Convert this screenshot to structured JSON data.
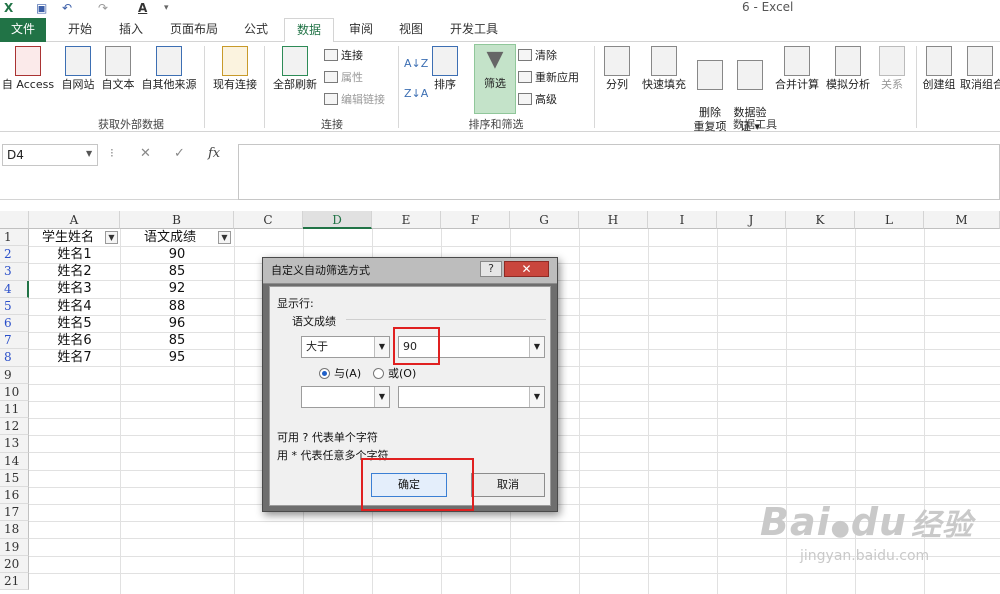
{
  "title_bar": {
    "title": "6 - Excel"
  },
  "tabs": [
    "文件",
    "开始",
    "插入",
    "页面布局",
    "公式",
    "数据",
    "审阅",
    "视图",
    "开发工具"
  ],
  "ribbon": {
    "external": {
      "btns": [
        "自 Access",
        "自网站",
        "自文本",
        "自其他来源",
        "现有连接"
      ],
      "label": "获取外部数据"
    },
    "connections": {
      "refresh": "全部刷新",
      "small": [
        "连接",
        "属性",
        "编辑链接"
      ],
      "label": "连接"
    },
    "sort": {
      "az": "A↓Z",
      "za": "Z↓A",
      "sort": "排序",
      "filter": "筛选",
      "small": [
        "清除",
        "重新应用",
        "高级"
      ],
      "label": "排序和筛选"
    },
    "tools": {
      "btns": [
        "分列",
        "快速填充",
        "删除\n重复项",
        "数据验\n证 ▾",
        "合并计算",
        "模拟分析",
        "关系"
      ],
      "label": "数据工具"
    },
    "outline": {
      "btns": [
        "创建组",
        "取消组合"
      ]
    }
  },
  "formula_bar": {
    "name_box": "D4",
    "cancel": "✕",
    "enter": "✓",
    "fx": "fx"
  },
  "columns": [
    "A",
    "B",
    "C",
    "D",
    "E",
    "F",
    "G",
    "H",
    "I",
    "J",
    "K",
    "L",
    "M"
  ],
  "rows": [
    "1",
    "2",
    "3",
    "4",
    "5",
    "6",
    "7",
    "8",
    "9",
    "10",
    "11",
    "12",
    "13",
    "14",
    "15",
    "16",
    "17",
    "18",
    "19",
    "20",
    "21"
  ],
  "table": {
    "headers": [
      "学生姓名",
      "语文成绩"
    ],
    "data": [
      [
        "姓名1",
        "90"
      ],
      [
        "姓名2",
        "85"
      ],
      [
        "姓名3",
        "92"
      ],
      [
        "姓名4",
        "88"
      ],
      [
        "姓名5",
        "96"
      ],
      [
        "姓名6",
        "85"
      ],
      [
        "姓名7",
        "95"
      ]
    ]
  },
  "dialog": {
    "title": "自定义自动筛选方式",
    "help": "?",
    "close": "✕",
    "show_rows": "显示行:",
    "field": "语文成绩",
    "op1": "大于",
    "val1": "90",
    "op2": "",
    "val2": "",
    "and": "与(A)",
    "or": "或(O)",
    "hint1": "可用 ? 代表单个字符",
    "hint2": "用 * 代表任意多个字符",
    "ok": "确定",
    "cancel": "取消"
  },
  "watermark": {
    "brand": "Bai",
    "brand2": "du",
    "cn": "经验",
    "url": "jingyan.baidu.com"
  }
}
